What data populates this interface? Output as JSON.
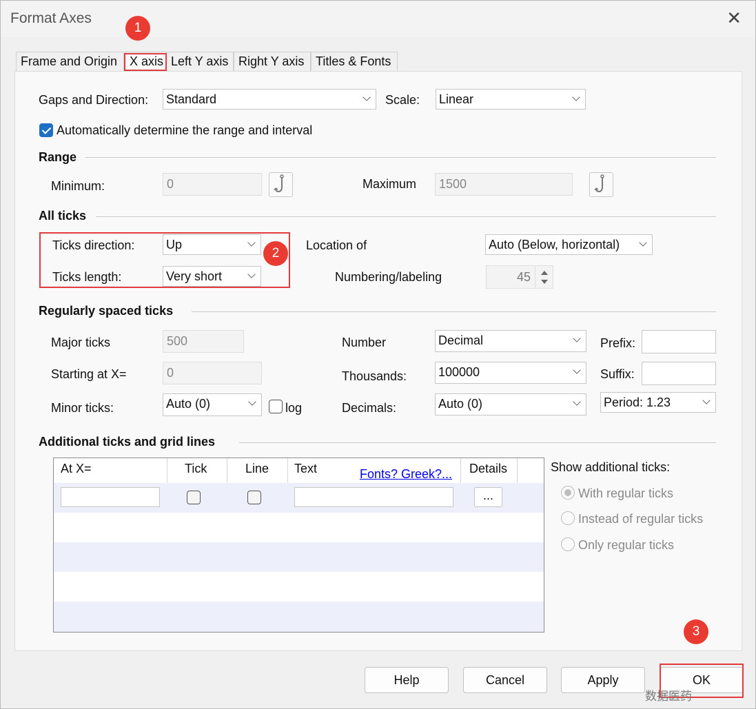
{
  "window": {
    "title": "Format Axes",
    "close_glyph": "✕"
  },
  "tabs": [
    "Frame and Origin",
    "X axis",
    "Left Y axis",
    "Right Y axis",
    "Titles & Fonts"
  ],
  "active_tab": "X axis",
  "top": {
    "gaps_label": "Gaps and Direction:",
    "gaps_value": "Standard",
    "scale_label": "Scale:",
    "scale_value": "Linear",
    "auto_label": "Automatically determine the range and interval",
    "auto_checked": true
  },
  "range": {
    "heading": "Range",
    "min_label": "Minimum:",
    "min_value": "0",
    "max_label": "Maximum",
    "max_value": "1500",
    "hook_icon": "hook-icon"
  },
  "all_ticks": {
    "heading": "All ticks",
    "direction_label": "Ticks direction:",
    "direction_value": "Up",
    "length_label": "Ticks length:",
    "length_value": "Very short",
    "location_label": "Location of",
    "location_value": "Auto (Below, horizontal)",
    "numbering_label": "Numbering/labeling",
    "numbering_value": "45"
  },
  "regular": {
    "heading": "Regularly spaced ticks",
    "major_label": "Major ticks",
    "major_value": "500",
    "start_label": "Starting at X=",
    "start_value": "0",
    "minor_label": "Minor ticks:",
    "minor_value": "Auto (0)",
    "log_label": "log",
    "number_label": "Number",
    "number_value": "Decimal",
    "thousands_label": "Thousands:",
    "thousands_value": "100000",
    "decimals_label": "Decimals:",
    "decimals_value": "Auto (0)",
    "prefix_label": "Prefix:",
    "prefix_value": "",
    "suffix_label": "Suffix:",
    "suffix_value": "",
    "period_value": "Period: 1.23"
  },
  "additional": {
    "heading": "Additional ticks and grid lines",
    "columns": [
      "At X=",
      "Tick",
      "Line",
      "Text",
      "Details"
    ],
    "fonts_link": "Fonts? Greek?...",
    "details_button": "...",
    "show_label": "Show additional ticks:",
    "options": [
      "With regular ticks",
      "Instead of regular ticks",
      "Only regular ticks"
    ],
    "selected_option": "With regular ticks"
  },
  "buttons": {
    "help": "Help",
    "cancel": "Cancel",
    "apply": "Apply",
    "ok": "OK"
  },
  "annotations": {
    "badge1": "1",
    "badge2": "2",
    "badge3": "3",
    "highlight_color": "#e23b3b"
  },
  "watermark": "数据医药"
}
